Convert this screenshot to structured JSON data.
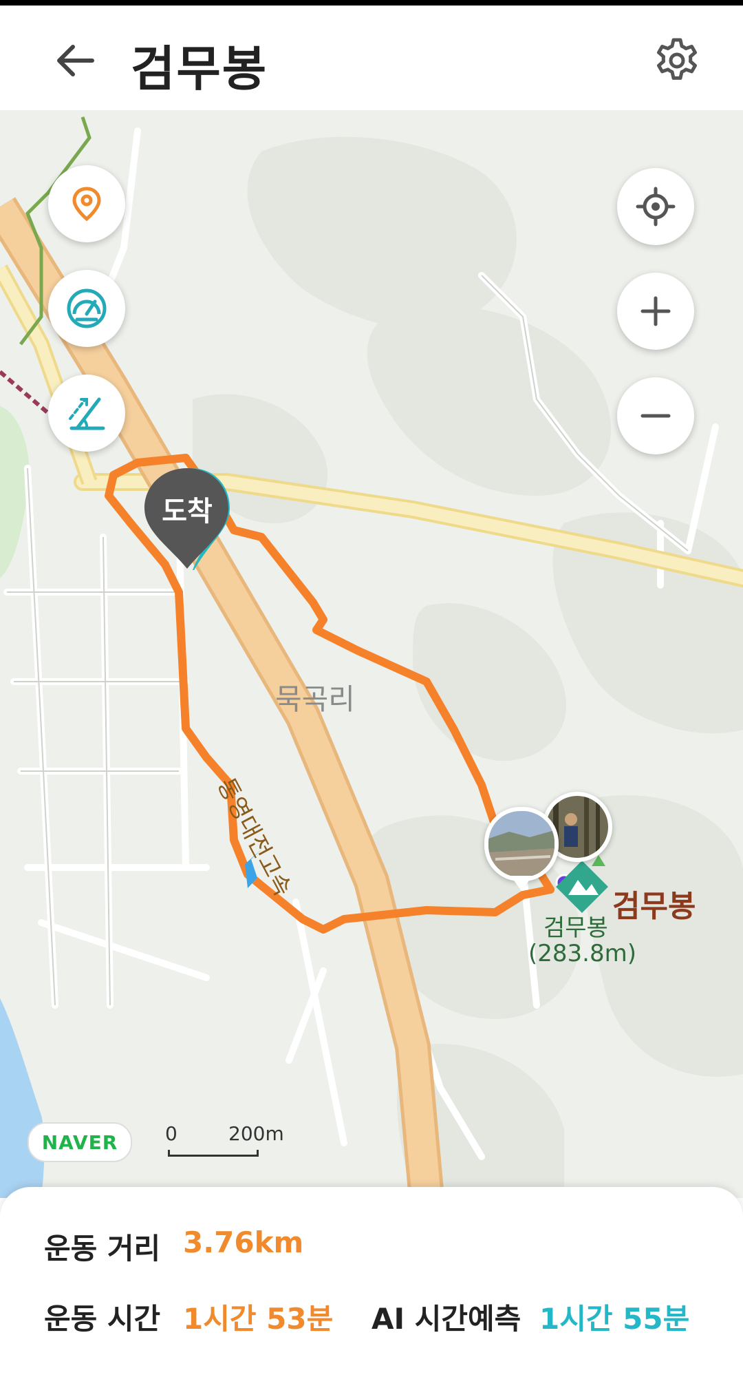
{
  "header": {
    "title": "검무봉",
    "back_icon": "arrow-left-icon",
    "settings_icon": "gear-icon"
  },
  "map": {
    "arrival_label": "도착",
    "village_label": "묵곡리",
    "road_label": "통영대전고속",
    "peak": {
      "name": "검무봉",
      "sub_label": "검무봉",
      "elevation": "(283.8m)"
    },
    "logo": "NAVER",
    "scale": {
      "start": "0",
      "end": "200m"
    },
    "left_buttons": [
      "map-pin-icon",
      "speedometer-icon",
      "ruler-slope-icon"
    ],
    "right_buttons": [
      "locate-crosshair-icon",
      "zoom-in-icon",
      "zoom-out-icon"
    ],
    "route_color": "#f5822a"
  },
  "stats": {
    "distance_label": "운동 거리",
    "distance_value": "3.76km",
    "time_label": "운동 시간",
    "time_value": "1시간 53분",
    "ai_label": "AI 시간예측",
    "ai_value": "1시간 55분"
  },
  "colors": {
    "accent_orange": "#f08a2c",
    "accent_teal": "#23b7c8"
  }
}
